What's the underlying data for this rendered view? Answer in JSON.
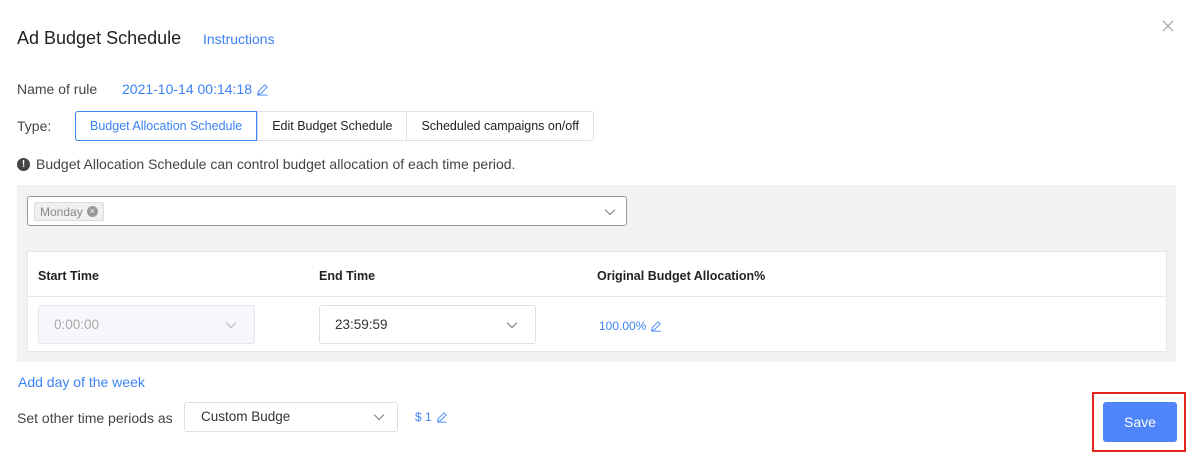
{
  "header": {
    "title": "Ad Budget Schedule",
    "instructions_link": "Instructions",
    "close_icon": "close-icon"
  },
  "rule": {
    "label": "Name of rule",
    "value": "2021-10-14 00:14:18"
  },
  "type": {
    "label": "Type:",
    "tabs": [
      {
        "label": "Budget Allocation Schedule",
        "active": true
      },
      {
        "label": "Edit Budget Schedule",
        "active": false
      },
      {
        "label": "Scheduled campaigns on/off",
        "active": false
      }
    ]
  },
  "notice": {
    "icon": "exclamation-circle-icon",
    "text": "Budget Allocation Schedule can control budget allocation of each time period."
  },
  "day_select": {
    "selected": [
      "Monday"
    ]
  },
  "schedule_table": {
    "columns": [
      "Start Time",
      "End Time",
      "Original Budget Allocation%"
    ],
    "rows": [
      {
        "start": "0:00:00",
        "end": "23:59:59",
        "allocation": "100.00%"
      }
    ]
  },
  "add_day_link": "Add day of the week",
  "other_periods": {
    "label": "Set other time periods as",
    "selected": "Custom Budge",
    "amount": "$ 1"
  },
  "footer": {
    "save_label": "Save"
  },
  "colors": {
    "accent": "#3b82f6",
    "primary_button": "#4f85fb",
    "highlight_frame": "#e5261d"
  }
}
